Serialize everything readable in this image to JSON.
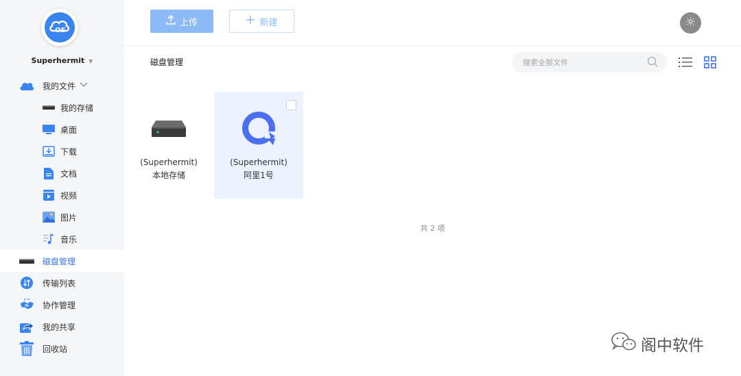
{
  "sidebar": {
    "user_name": "Superhermit",
    "items": [
      {
        "label": "我的文件"
      },
      {
        "label": "我的存储"
      },
      {
        "label": "桌面"
      },
      {
        "label": "下载"
      },
      {
        "label": "文档"
      },
      {
        "label": "视频"
      },
      {
        "label": "图片"
      },
      {
        "label": "音乐"
      },
      {
        "label": "磁盘管理"
      },
      {
        "label": "传输列表"
      },
      {
        "label": "协作管理"
      },
      {
        "label": "我的共享"
      },
      {
        "label": "回收站"
      }
    ]
  },
  "toolbar": {
    "upload_label": "上传",
    "new_label": "新建"
  },
  "main": {
    "breadcrumb": "磁盘管理",
    "search_placeholder": "搜索全部文件",
    "tiles": [
      {
        "line1": "(Superhermit)",
        "line2": "本地存储"
      },
      {
        "line1": "(Superhermit)",
        "line2": "阿里1号"
      }
    ],
    "count_text": "共 2 项"
  },
  "watermark": "阁中软件",
  "colors": {
    "accent": "#3a74e8",
    "upload_button": "#8db9f5",
    "sidebar_bg": "#f5f6f8",
    "selected_tile_bg": "#ecf3fe"
  }
}
